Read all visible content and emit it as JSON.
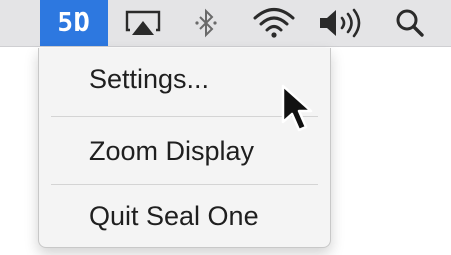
{
  "menubar": {
    "app_logo": "5Ɒ",
    "icons": {
      "app": "seal-one-logo-icon",
      "airplay": "airplay-icon",
      "bluetooth": "bluetooth-icon",
      "wifi": "wifi-icon",
      "volume": "volume-icon",
      "search": "spotlight-search-icon"
    },
    "accent_color": "#2d78e0"
  },
  "menu": {
    "items": [
      {
        "label": "Settings..."
      },
      {
        "label": "Zoom Display"
      },
      {
        "label": "Quit Seal One"
      }
    ]
  }
}
